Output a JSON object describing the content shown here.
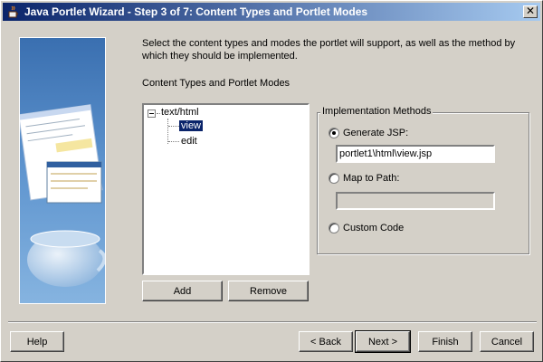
{
  "window": {
    "title": "Java Portlet Wizard - Step 3 of 7: Content Types and Portlet Modes",
    "close_glyph": "✕"
  },
  "intro": {
    "text": "Select the content types and modes the portlet will support, as well as the method by which they should be implemented."
  },
  "tree": {
    "label": "Content Types and Portlet Modes",
    "root": "text/html",
    "children": [
      "view",
      "edit"
    ],
    "selected": "view"
  },
  "buttons": {
    "add": "Add",
    "remove": "Remove"
  },
  "implementation": {
    "group_label": "Implementation Methods",
    "generate_jsp_label": "Generate JSP:",
    "generate_jsp_value": "portlet1\\html\\view.jsp",
    "map_to_path_label": "Map to Path:",
    "map_to_path_value": "",
    "custom_code_label": "Custom Code",
    "selected_option": "Generate JSP:"
  },
  "footer": {
    "help": "Help",
    "back": "< Back",
    "next": "Next >",
    "finish": "Finish",
    "cancel": "Cancel"
  },
  "colors": {
    "dialog_bg": "#d4d0c8",
    "titlebar_start": "#0a246a",
    "titlebar_end": "#a6caf0",
    "selection": "#0a246a"
  }
}
